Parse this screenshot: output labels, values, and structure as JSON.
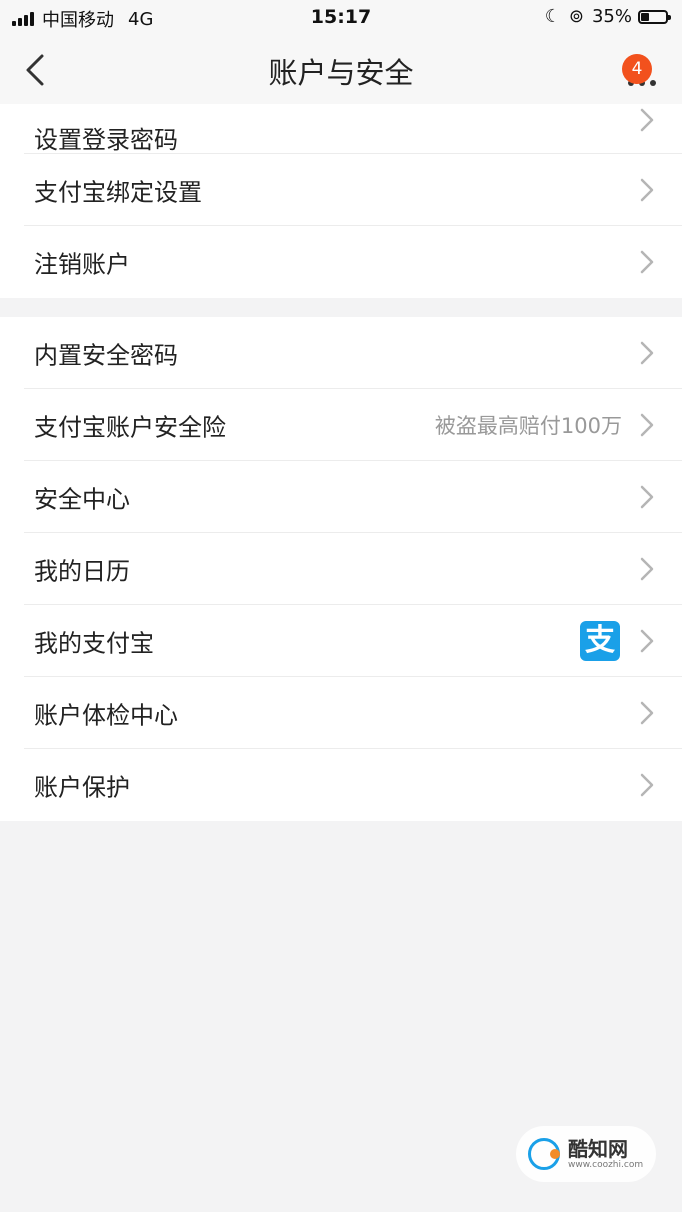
{
  "status_bar": {
    "carrier": "中国移动",
    "network": "4G",
    "time": "15:17",
    "battery_percent_text": "35%",
    "battery_level": 0.35
  },
  "nav": {
    "title": "账户与安全",
    "badge_count": "4"
  },
  "group1": {
    "items": [
      {
        "label": "设置登录密码"
      },
      {
        "label": "支付宝绑定设置"
      },
      {
        "label": "注销账户"
      }
    ]
  },
  "group2": {
    "items": [
      {
        "label": "内置安全密码"
      },
      {
        "label": "支付宝账户安全险",
        "value": "被盗最高赔付100万"
      },
      {
        "label": "安全中心"
      },
      {
        "label": "我的日历"
      },
      {
        "label": "我的支付宝",
        "icon": "alipay-icon",
        "icon_glyph": "支"
      },
      {
        "label": "账户体检中心"
      },
      {
        "label": "账户保护"
      }
    ]
  },
  "watermark": {
    "title": "酷知网",
    "url": "www.coozhi.com"
  },
  "colors": {
    "badge": "#f2511d",
    "alipay": "#1aa0e8",
    "background": "#f3f3f4"
  }
}
